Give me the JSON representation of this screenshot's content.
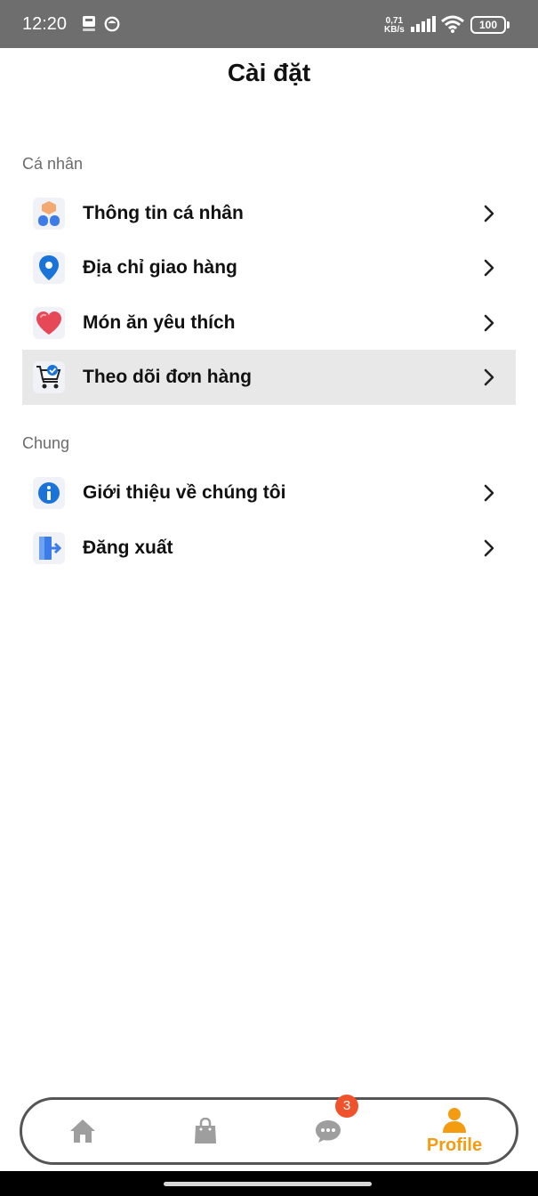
{
  "status_bar": {
    "time": "12:20",
    "speed_value": "0,71",
    "speed_unit": "KB/s",
    "battery": "100"
  },
  "page": {
    "title": "Cài đặt"
  },
  "sections": {
    "personal": {
      "label": "Cá nhân",
      "items": [
        {
          "label": "Thông tin cá nhân",
          "icon": "person-icon"
        },
        {
          "label": "Địa chỉ giao hàng",
          "icon": "location-pin-icon"
        },
        {
          "label": "Món ăn yêu thích",
          "icon": "heart-icon"
        },
        {
          "label": "Theo dõi đơn hàng",
          "icon": "cart-check-icon",
          "active": true
        }
      ]
    },
    "general": {
      "label": "Chung",
      "items": [
        {
          "label": "Giới thiệu về chúng tôi",
          "icon": "info-icon"
        },
        {
          "label": "Đăng xuất",
          "icon": "logout-icon"
        }
      ]
    }
  },
  "bottom_nav": {
    "items": [
      {
        "icon": "home-icon"
      },
      {
        "icon": "bag-icon"
      },
      {
        "icon": "chat-icon",
        "badge": "3"
      },
      {
        "icon": "profile-icon",
        "label": "Profile",
        "active": true
      }
    ],
    "colors": {
      "active": "#f39c12",
      "inactive": "#9e9e9e",
      "badge": "#f0532b"
    }
  }
}
